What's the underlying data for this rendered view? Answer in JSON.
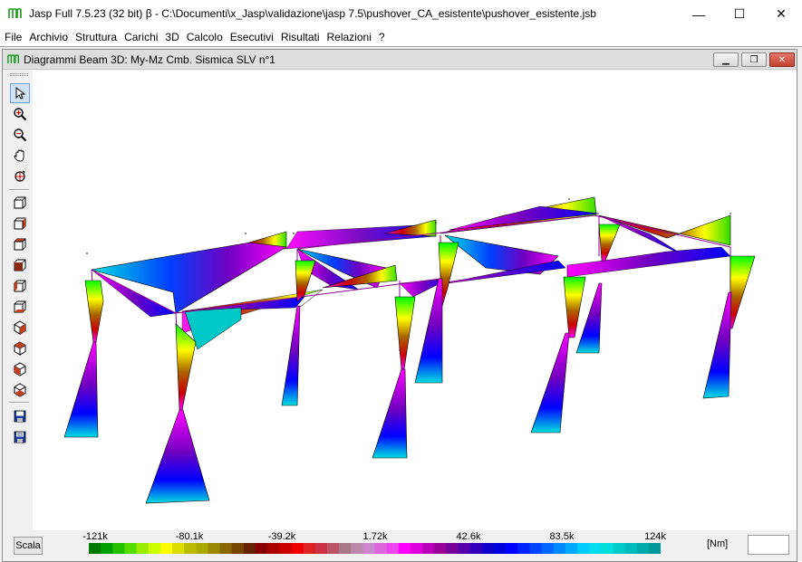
{
  "app": {
    "title": "Jasp Full 7.5.23 (32 bit)  β - C:\\Documenti\\x_Jasp\\validazione\\jasp 7.5\\pushover_CA_esistente\\pushover_esistente.jsb",
    "accent_color": "#1a9a1a"
  },
  "window_controls": {
    "minimize": "—",
    "maximize": "☐",
    "close": "✕"
  },
  "menu": {
    "items": [
      "File",
      "Archivio",
      "Struttura",
      "Carichi",
      "3D",
      "Calcolo",
      "Esecutivi",
      "Risultati",
      "Relazioni",
      "?"
    ]
  },
  "child_window": {
    "title": "Diagrammi Beam 3D: My-Mz Cmb. Sismica SLV n°1",
    "controls": {
      "minimize": "▁",
      "restore": "❐",
      "close": "✕"
    }
  },
  "toolbar": {
    "tools": [
      {
        "name": "select-tool",
        "icon": "arrow-cursor-icon",
        "active": true
      },
      {
        "name": "zoom-in-tool",
        "icon": "zoom-in-icon",
        "active": false
      },
      {
        "name": "zoom-out-tool",
        "icon": "zoom-out-icon",
        "active": false
      },
      {
        "name": "pan-tool",
        "icon": "hand-icon",
        "active": false
      },
      {
        "name": "rotate-tool",
        "icon": "rotate-icon",
        "active": false
      },
      {
        "name": "view-3d-front-tool",
        "icon": "cube-front-icon",
        "active": false
      },
      {
        "name": "view-3d-right-tool",
        "icon": "cube-right-icon",
        "active": false
      },
      {
        "name": "view-3d-top-tool",
        "icon": "cube-top-icon",
        "active": false
      },
      {
        "name": "view-3d-back-tool",
        "icon": "cube-back-icon",
        "active": false
      },
      {
        "name": "view-3d-left-tool",
        "icon": "cube-left-icon",
        "active": false
      },
      {
        "name": "view-3d-bottom-tool",
        "icon": "cube-bottom-icon",
        "active": false
      },
      {
        "name": "view-iso-1-tool",
        "icon": "cube-iso-1-icon",
        "active": false
      },
      {
        "name": "view-iso-2-tool",
        "icon": "cube-iso-2-icon",
        "active": false
      },
      {
        "name": "view-iso-3-tool",
        "icon": "cube-iso-3-icon",
        "active": false
      },
      {
        "name": "view-iso-4-tool",
        "icon": "cube-iso-4-icon",
        "active": false
      },
      {
        "name": "save-tool",
        "icon": "floppy-icon",
        "active": false
      },
      {
        "name": "save-as-tool",
        "icon": "floppy-alt-icon",
        "active": false
      }
    ]
  },
  "legend": {
    "scala_label": "Scala",
    "ticks": [
      "-121k",
      "-80.1k",
      "-39.2k",
      "1.72k",
      "42.6k",
      "83.5k",
      "124k"
    ],
    "unit": "[Nm]",
    "value_box": "",
    "colors": [
      "#007a00",
      "#00a000",
      "#22c000",
      "#55dd00",
      "#99ee00",
      "#ccff00",
      "#ffff00",
      "#dddd00",
      "#bbbb00",
      "#aaaa00",
      "#998800",
      "#886600",
      "#774400",
      "#662200",
      "#880000",
      "#aa0000",
      "#cc0000",
      "#ee0000",
      "#dd2222",
      "#cc3344",
      "#bb5566",
      "#aa7788",
      "#bb88aa",
      "#cc88cc",
      "#dd66dd",
      "#ee44ee",
      "#ff00ff",
      "#dd00dd",
      "#bb00bb",
      "#990099",
      "#770099",
      "#5500aa",
      "#3300bb",
      "#1100cc",
      "#0000dd",
      "#0000ff",
      "#0022ff",
      "#0044ff",
      "#0066ff",
      "#0088ff",
      "#00aaff",
      "#00ccff",
      "#00ddee",
      "#00dddd",
      "#00cccc",
      "#00bbbb",
      "#00aaaa",
      "#009999"
    ]
  }
}
